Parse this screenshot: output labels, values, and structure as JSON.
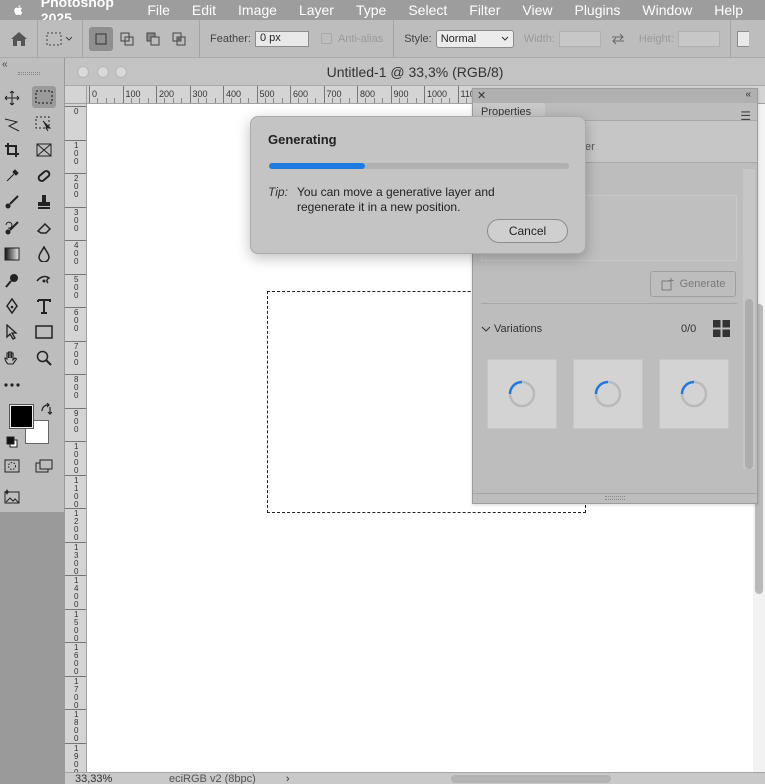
{
  "menubar": {
    "app_name": "Photoshop 2025",
    "items": [
      "File",
      "Edit",
      "Image",
      "Layer",
      "Type",
      "Select",
      "Filter",
      "View",
      "Plugins",
      "Window",
      "Help"
    ]
  },
  "options_bar": {
    "feather_label": "Feather:",
    "feather_value": "0 px",
    "antialias_label": "Anti-alias",
    "style_label": "Style:",
    "style_value": "Normal",
    "width_label": "Width:",
    "height_label": "Height:"
  },
  "document": {
    "title": "Untitled-1 @ 33,3% (RGB/8)",
    "ruler_h_labels": [
      "0",
      "100",
      "200",
      "300",
      "400",
      "500",
      "600",
      "700",
      "800",
      "900",
      "1000",
      "1100"
    ],
    "ruler_v_labels": [
      "0",
      "100",
      "200",
      "300",
      "400",
      "500",
      "600",
      "700",
      "800",
      "900",
      "1000",
      "1100",
      "1200",
      "1300",
      "1400",
      "1500",
      "1600",
      "1700",
      "1800",
      "1900"
    ],
    "zoom": "33,33%",
    "color_profile": "eciRGB v2 (8bpc)",
    "status_arrow": "›"
  },
  "properties": {
    "tab_label": "Properties",
    "sub_partial": "er",
    "generate_label": "Generate",
    "variations_label": "Variations",
    "variations_count": "0/0"
  },
  "dialog": {
    "title": "Generating",
    "progress": 0.32,
    "tip_label": "Tip:",
    "tip_text": "You can move a generative layer and regenerate it in a new position.",
    "cancel_label": "Cancel"
  },
  "colors": {
    "accent": "#1f7ae0",
    "menubar_bg": "#9d9d9d",
    "panel_bg": "#bdbdbd"
  }
}
